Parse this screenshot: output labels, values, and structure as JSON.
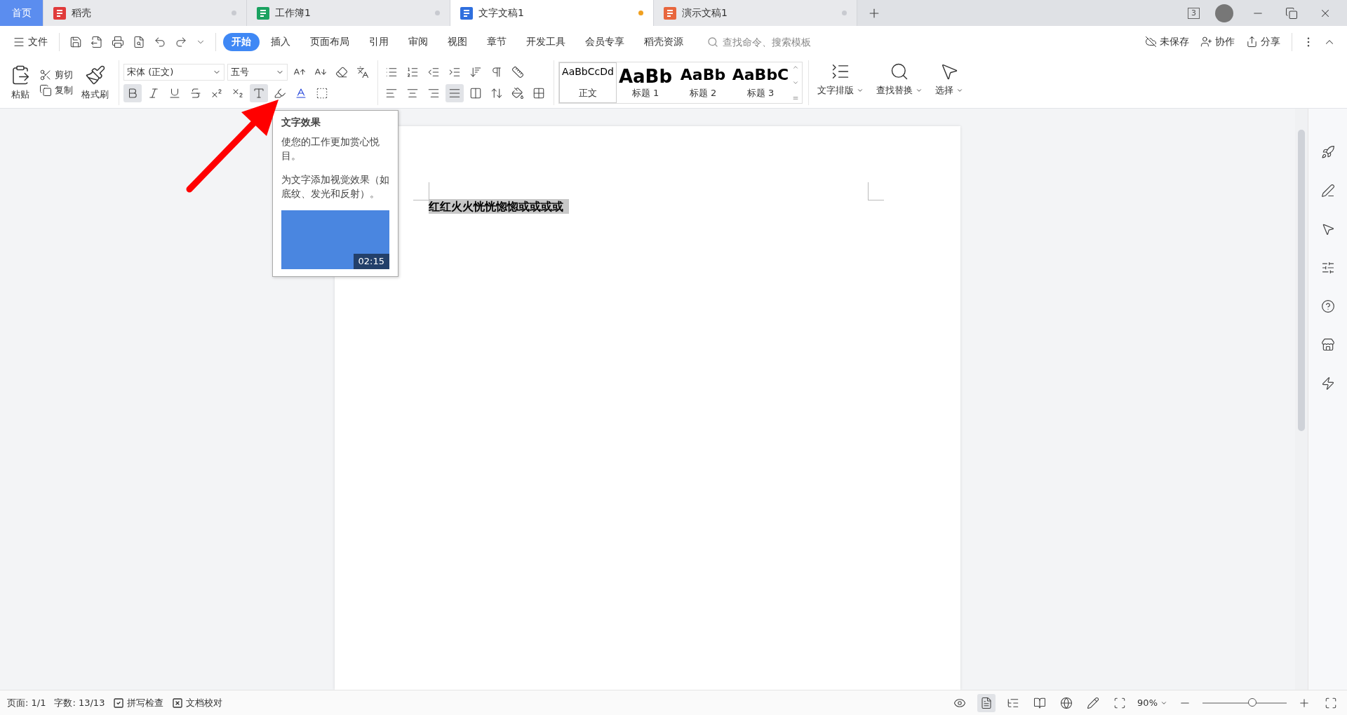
{
  "tabs": [
    {
      "label": "首页",
      "kind": "home",
      "selected": false,
      "unsaved": false
    },
    {
      "label": "稻壳",
      "kind": "docer",
      "selected": false,
      "unsaved": false
    },
    {
      "label": "工作簿1",
      "kind": "sheet",
      "selected": false,
      "unsaved": false
    },
    {
      "label": "文字文稿1",
      "kind": "writer",
      "selected": true,
      "unsaved": true
    },
    {
      "label": "演示文稿1",
      "kind": "slides",
      "selected": false,
      "unsaved": false
    }
  ],
  "window_count": "3",
  "menu": {
    "file": "文件",
    "items": [
      {
        "label": "开始",
        "selected": true
      },
      {
        "label": "插入",
        "selected": false
      },
      {
        "label": "页面布局",
        "selected": false
      },
      {
        "label": "引用",
        "selected": false
      },
      {
        "label": "审阅",
        "selected": false
      },
      {
        "label": "视图",
        "selected": false
      },
      {
        "label": "章节",
        "selected": false
      },
      {
        "label": "开发工具",
        "selected": false
      },
      {
        "label": "会员专享",
        "selected": false
      },
      {
        "label": "稻壳资源",
        "selected": false
      }
    ],
    "search": {
      "placeholder": "查找命令、搜索模板"
    },
    "actions": [
      {
        "label": "未保存",
        "kind": "cloud"
      },
      {
        "label": "协作",
        "kind": "user"
      },
      {
        "label": "分享",
        "kind": "share"
      }
    ]
  },
  "ribbon": {
    "paste": "粘贴",
    "cut": "剪切",
    "copy": "复制",
    "painter": "格式刷",
    "font": "宋体 (正文)",
    "size": "五号",
    "formats": [
      {
        "kind": "bold",
        "selected": true
      },
      {
        "kind": "italic",
        "selected": false
      },
      {
        "kind": "underline",
        "selected": false
      },
      {
        "kind": "strike",
        "selected": false
      },
      {
        "kind": "sup",
        "selected": false
      },
      {
        "kind": "sub",
        "selected": false
      },
      {
        "kind": "effect",
        "selected": true
      }
    ],
    "aligns": [
      {
        "kind": "left",
        "selected": false
      },
      {
        "kind": "center",
        "selected": false
      },
      {
        "kind": "right",
        "selected": false
      },
      {
        "kind": "justify",
        "selected": true
      },
      {
        "kind": "distribute",
        "selected": false
      }
    ],
    "styles": [
      {
        "preview": "AaBbCcDd",
        "label": "正文",
        "selected": true
      },
      {
        "preview": "AaBb",
        "label": "标题 1",
        "selected": false
      },
      {
        "preview": "AaBb",
        "label": "标题 2",
        "selected": false
      },
      {
        "preview": "AaBbC",
        "label": "标题 3",
        "selected": false
      }
    ],
    "big": [
      {
        "label": "文字排版",
        "kind": "layout"
      },
      {
        "label": "查找替换",
        "kind": "find"
      },
      {
        "label": "选择",
        "kind": "select"
      }
    ]
  },
  "tooltip": {
    "title": "文字效果",
    "lines": [
      "使您的工作更加赏心悦目。",
      "为文字添加视觉效果（如底纹、发光和反射）。"
    ],
    "duration": "02:15"
  },
  "document": {
    "text": "红红火火恍恍惚惚或或或或",
    "selected": true
  },
  "status": {
    "page": "页面: 1/1",
    "words": "字数: 13/13",
    "spell": "拼写检查",
    "proof": "文档校对",
    "zoom": "90%",
    "level": 0.6
  }
}
